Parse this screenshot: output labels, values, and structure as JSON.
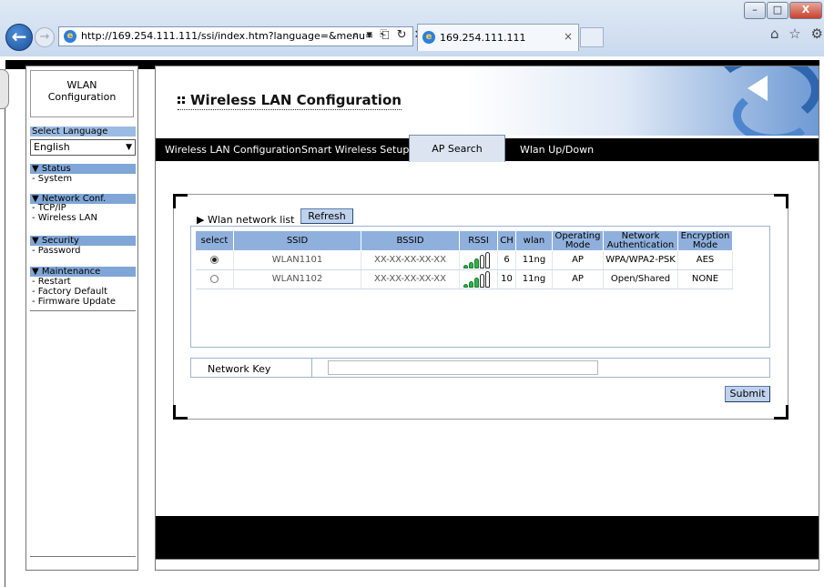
{
  "browser": {
    "url": "http://169.254.111.111/ssi/index.htm?language=&menu=",
    "address_tools": "⌕ ▾ ⎗ ↻ ✕",
    "tab_title": "169.254.111.111",
    "tab_close": "×",
    "window_buttons": {
      "minimize": "–",
      "maximize": "□",
      "close": "X"
    },
    "back": "←",
    "forward": "→",
    "right_icons": "⌂ ☆ ⚙"
  },
  "sidebar": {
    "title_line1": "WLAN",
    "title_line2": "Configuration",
    "language_header": "Select Language",
    "language_value": "English",
    "sections": [
      {
        "header": "▼ Status",
        "items": [
          "- System"
        ]
      },
      {
        "header": "▼ Network Conf.",
        "items": [
          "- TCP/IP",
          "- Wireless LAN"
        ]
      },
      {
        "header": "▼ Security",
        "items": [
          "- Password"
        ]
      },
      {
        "header": "▼ Maintenance",
        "items": [
          "- Restart",
          "- Factory Default",
          "- Firmware Update"
        ]
      }
    ]
  },
  "header": {
    "title": "Wireless LAN Configuration"
  },
  "nav": {
    "tabs": [
      "Wireless LAN Configuration",
      "Smart Wireless Setup",
      "AP Search",
      "Wlan Up/Down"
    ],
    "active_tab": "AP Search"
  },
  "content": {
    "list_label": "▶ Wlan network list",
    "refresh_label": "Refresh",
    "columns": [
      "select",
      "SSID",
      "BSSID",
      "RSSI",
      "CH",
      "wlan",
      "Operating Mode",
      "Network Authentication",
      "Encryption Mode"
    ],
    "rows": [
      {
        "selected": true,
        "ssid": "WLAN1101",
        "bssid": "XX-XX-XX-XX-XX",
        "rssi_bars": 3,
        "ch": "6",
        "wlan": "11ng",
        "mode": "AP",
        "auth": "WPA/WPA2-PSK",
        "enc": "AES"
      },
      {
        "selected": false,
        "ssid": "WLAN1102",
        "bssid": "XX-XX-XX-XX-XX",
        "rssi_bars": 3,
        "ch": "10",
        "wlan": "11ng",
        "mode": "AP",
        "auth": "Open/Shared",
        "enc": "NONE"
      }
    ],
    "network_key_label": "Network Key",
    "network_key_value": "",
    "submit_label": "Submit"
  },
  "colors": {
    "accent": "#8fb0dc",
    "nav_bg": "#000000",
    "signal_green": "#2db34a"
  }
}
